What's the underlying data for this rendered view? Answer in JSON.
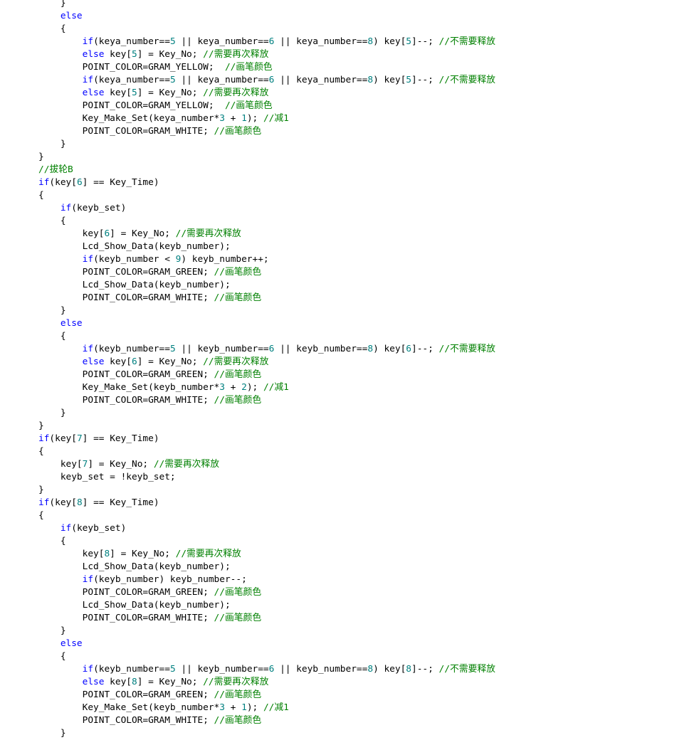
{
  "editor": {
    "lines": [
      [
        [
          "",
          "    }"
        ]
      ],
      [
        [
          "kw",
          "    else"
        ]
      ],
      [
        [
          "",
          "    {"
        ]
      ],
      [
        [
          "",
          "        "
        ],
        [
          "kw",
          "if"
        ],
        [
          "",
          "(keya_number=="
        ],
        [
          "num",
          "5"
        ],
        [
          "",
          " || keya_number=="
        ],
        [
          "num",
          "6"
        ],
        [
          "",
          " || keya_number=="
        ],
        [
          "num",
          "8"
        ],
        [
          "",
          ") key["
        ],
        [
          "num",
          "5"
        ],
        [
          "",
          "]--; "
        ],
        [
          "cm",
          "//不需要释放"
        ]
      ],
      [
        [
          "",
          "        "
        ],
        [
          "kw",
          "else"
        ],
        [
          "",
          " key["
        ],
        [
          "num",
          "5"
        ],
        [
          "",
          "] = Key_No; "
        ],
        [
          "cm",
          "//需要再次释放"
        ]
      ],
      [
        [
          "",
          "        POINT_COLOR=GRAM_YELLOW;  "
        ],
        [
          "cm",
          "//画笔颜色"
        ]
      ],
      [
        [
          "",
          "        "
        ],
        [
          "kw",
          "if"
        ],
        [
          "",
          "(keya_number=="
        ],
        [
          "num",
          "5"
        ],
        [
          "",
          " || keya_number=="
        ],
        [
          "num",
          "6"
        ],
        [
          "",
          " || keya_number=="
        ],
        [
          "num",
          "8"
        ],
        [
          "",
          ") key["
        ],
        [
          "num",
          "5"
        ],
        [
          "",
          "]--; "
        ],
        [
          "cm",
          "//不需要释放"
        ]
      ],
      [
        [
          "",
          "        "
        ],
        [
          "kw",
          "else"
        ],
        [
          "",
          " key["
        ],
        [
          "num",
          "5"
        ],
        [
          "",
          "] = Key_No; "
        ],
        [
          "cm",
          "//需要再次释放"
        ]
      ],
      [
        [
          "",
          "        POINT_COLOR=GRAM_YELLOW;  "
        ],
        [
          "cm",
          "//画笔颜色"
        ]
      ],
      [
        [
          "",
          "        Key_Make_Set(keya_number*"
        ],
        [
          "num",
          "3"
        ],
        [
          "",
          " + "
        ],
        [
          "num",
          "1"
        ],
        [
          "",
          "); "
        ],
        [
          "cm",
          "//减1"
        ]
      ],
      [
        [
          "",
          "        POINT_COLOR=GRAM_WHITE; "
        ],
        [
          "cm",
          "//画笔颜色"
        ]
      ],
      [
        [
          "",
          "    }"
        ]
      ],
      [
        [
          "",
          "}"
        ]
      ],
      [
        [
          "cm",
          "//拔轮B"
        ]
      ],
      [
        [
          "kw",
          "if"
        ],
        [
          "",
          "(key["
        ],
        [
          "num",
          "6"
        ],
        [
          "",
          "] == Key_Time)"
        ]
      ],
      [
        [
          "",
          "{"
        ]
      ],
      [
        [
          "",
          "    "
        ],
        [
          "kw",
          "if"
        ],
        [
          "",
          "(keyb_set)"
        ]
      ],
      [
        [
          "",
          "    {"
        ]
      ],
      [
        [
          "",
          "        key["
        ],
        [
          "num",
          "6"
        ],
        [
          "",
          "] = Key_No; "
        ],
        [
          "cm",
          "//需要再次释放"
        ]
      ],
      [
        [
          "",
          "        Lcd_Show_Data(keyb_number);"
        ]
      ],
      [
        [
          "",
          "        "
        ],
        [
          "kw",
          "if"
        ],
        [
          "",
          "(keyb_number < "
        ],
        [
          "num",
          "9"
        ],
        [
          "",
          ") keyb_number++;"
        ]
      ],
      [
        [
          "",
          "        POINT_COLOR=GRAM_GREEN; "
        ],
        [
          "cm",
          "//画笔颜色"
        ]
      ],
      [
        [
          "",
          "        Lcd_Show_Data(keyb_number);"
        ]
      ],
      [
        [
          "",
          "        POINT_COLOR=GRAM_WHITE; "
        ],
        [
          "cm",
          "//画笔颜色"
        ]
      ],
      [
        [
          "",
          "    }"
        ]
      ],
      [
        [
          "kw",
          "    else"
        ]
      ],
      [
        [
          "",
          "    {"
        ]
      ],
      [
        [
          "",
          "        "
        ],
        [
          "kw",
          "if"
        ],
        [
          "",
          "(keyb_number=="
        ],
        [
          "num",
          "5"
        ],
        [
          "",
          " || keyb_number=="
        ],
        [
          "num",
          "6"
        ],
        [
          "",
          " || keyb_number=="
        ],
        [
          "num",
          "8"
        ],
        [
          "",
          ") key["
        ],
        [
          "num",
          "6"
        ],
        [
          "",
          "]--; "
        ],
        [
          "cm",
          "//不需要释放"
        ]
      ],
      [
        [
          "",
          "        "
        ],
        [
          "kw",
          "else"
        ],
        [
          "",
          " key["
        ],
        [
          "num",
          "6"
        ],
        [
          "",
          "] = Key_No; "
        ],
        [
          "cm",
          "//需要再次释放"
        ]
      ],
      [
        [
          "",
          "        POINT_COLOR=GRAM_GREEN; "
        ],
        [
          "cm",
          "//画笔颜色"
        ]
      ],
      [
        [
          "",
          "        Key_Make_Set(keyb_number*"
        ],
        [
          "num",
          "3"
        ],
        [
          "",
          " + "
        ],
        [
          "num",
          "2"
        ],
        [
          "",
          "); "
        ],
        [
          "cm",
          "//减1"
        ]
      ],
      [
        [
          "",
          "        POINT_COLOR=GRAM_WHITE; "
        ],
        [
          "cm",
          "//画笔颜色"
        ]
      ],
      [
        [
          "",
          "    }"
        ]
      ],
      [
        [
          "",
          "}"
        ]
      ],
      [
        [
          "kw",
          "if"
        ],
        [
          "",
          "(key["
        ],
        [
          "num",
          "7"
        ],
        [
          "",
          "] == Key_Time)"
        ]
      ],
      [
        [
          "",
          "{"
        ]
      ],
      [
        [
          "",
          "    key["
        ],
        [
          "num",
          "7"
        ],
        [
          "",
          "] = Key_No; "
        ],
        [
          "cm",
          "//需要再次释放"
        ]
      ],
      [
        [
          "",
          "    keyb_set = !keyb_set;"
        ]
      ],
      [
        [
          "",
          "}"
        ]
      ],
      [
        [
          "kw",
          "if"
        ],
        [
          "",
          "(key["
        ],
        [
          "num",
          "8"
        ],
        [
          "",
          "] == Key_Time)"
        ]
      ],
      [
        [
          "",
          "{"
        ]
      ],
      [
        [
          "",
          "    "
        ],
        [
          "kw",
          "if"
        ],
        [
          "",
          "(keyb_set)"
        ]
      ],
      [
        [
          "",
          "    {"
        ]
      ],
      [
        [
          "",
          "        key["
        ],
        [
          "num",
          "8"
        ],
        [
          "",
          "] = Key_No; "
        ],
        [
          "cm",
          "//需要再次释放"
        ]
      ],
      [
        [
          "",
          "        Lcd_Show_Data(keyb_number);"
        ]
      ],
      [
        [
          "",
          "        "
        ],
        [
          "kw",
          "if"
        ],
        [
          "",
          "(keyb_number) keyb_number--;"
        ]
      ],
      [
        [
          "",
          "        POINT_COLOR=GRAM_GREEN; "
        ],
        [
          "cm",
          "//画笔颜色"
        ]
      ],
      [
        [
          "",
          "        Lcd_Show_Data(keyb_number);"
        ]
      ],
      [
        [
          "",
          "        POINT_COLOR=GRAM_WHITE; "
        ],
        [
          "cm",
          "//画笔颜色"
        ]
      ],
      [
        [
          "",
          "    }"
        ]
      ],
      [
        [
          "kw",
          "    else"
        ]
      ],
      [
        [
          "",
          "    {"
        ]
      ],
      [
        [
          "",
          "        "
        ],
        [
          "kw",
          "if"
        ],
        [
          "",
          "(keyb_number=="
        ],
        [
          "num",
          "5"
        ],
        [
          "",
          " || keyb_number=="
        ],
        [
          "num",
          "6"
        ],
        [
          "",
          " || keyb_number=="
        ],
        [
          "num",
          "8"
        ],
        [
          "",
          ") key["
        ],
        [
          "num",
          "8"
        ],
        [
          "",
          "]--; "
        ],
        [
          "cm",
          "//不需要释放"
        ]
      ],
      [
        [
          "",
          "        "
        ],
        [
          "kw",
          "else"
        ],
        [
          "",
          " key["
        ],
        [
          "num",
          "8"
        ],
        [
          "",
          "] = Key_No; "
        ],
        [
          "cm",
          "//需要再次释放"
        ]
      ],
      [
        [
          "",
          "        POINT_COLOR=GRAM_GREEN; "
        ],
        [
          "cm",
          "//画笔颜色"
        ]
      ],
      [
        [
          "",
          "        Key_Make_Set(keyb_number*"
        ],
        [
          "num",
          "3"
        ],
        [
          "",
          " + "
        ],
        [
          "num",
          "1"
        ],
        [
          "",
          "); "
        ],
        [
          "cm",
          "//减1"
        ]
      ],
      [
        [
          "",
          "        POINT_COLOR=GRAM_WHITE; "
        ],
        [
          "cm",
          "//画笔颜色"
        ]
      ],
      [
        [
          "",
          "    }"
        ]
      ]
    ]
  },
  "colors": {
    "background": "#ffffff",
    "text": "#000000",
    "keyword": "#0000ff",
    "number": "#008080",
    "comment": "#008000"
  }
}
